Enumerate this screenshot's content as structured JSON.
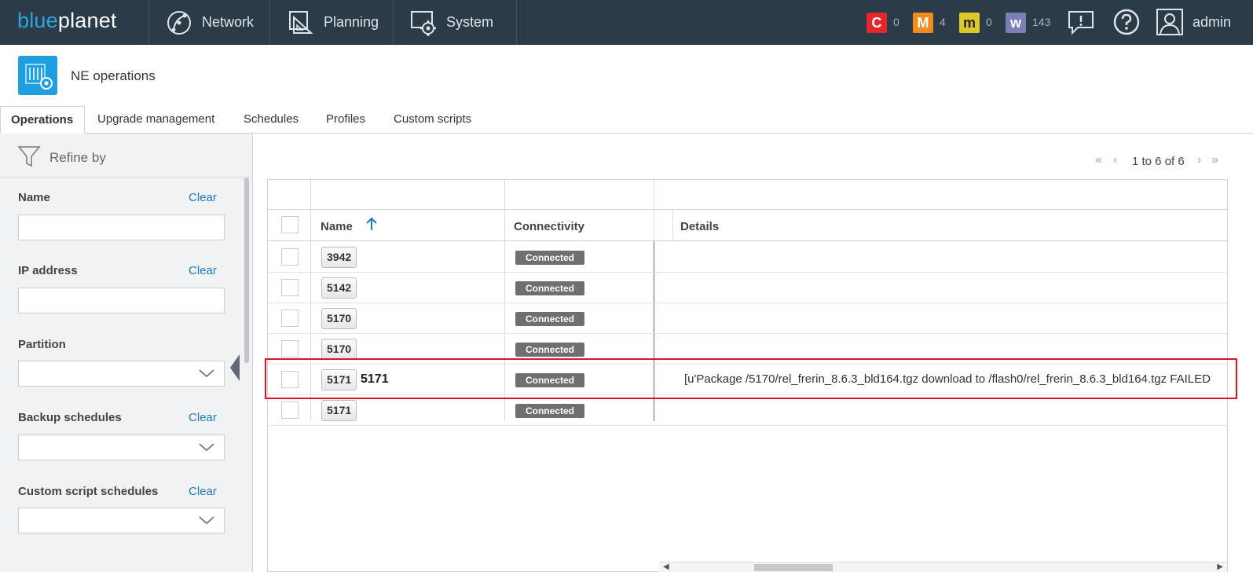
{
  "app": {
    "logo_blue": "blue",
    "logo_rest": "planet",
    "nav": [
      {
        "label": "Network",
        "icon": "network-icon"
      },
      {
        "label": "Planning",
        "icon": "planning-icon"
      },
      {
        "label": "System",
        "icon": "system-gear-icon"
      }
    ],
    "alarms": [
      {
        "letter": "C",
        "count": "0",
        "color": "#e3262b"
      },
      {
        "letter": "M",
        "count": "4",
        "color": "#f08c1e"
      },
      {
        "letter": "m",
        "count": "0",
        "color": "#d9c92a"
      },
      {
        "letter": "w",
        "count": "143",
        "color": "#7b7fb8"
      }
    ],
    "user": "admin"
  },
  "page": {
    "title": "NE operations",
    "tabs": [
      "Operations",
      "Upgrade management",
      "Schedules",
      "Profiles",
      "Custom scripts"
    ],
    "active_tab": "Operations"
  },
  "sidebar": {
    "refine_label": "Refine by",
    "clear_label": "Clear",
    "filters": [
      {
        "label": "Name",
        "type": "input",
        "value": ""
      },
      {
        "label": "IP address",
        "type": "input",
        "value": ""
      },
      {
        "label": "Partition",
        "type": "select",
        "value": ""
      },
      {
        "label": "Backup schedules",
        "type": "select",
        "value": ""
      },
      {
        "label": "Custom script schedules",
        "type": "select",
        "value": ""
      }
    ]
  },
  "pagination": {
    "text": "1 to 6 of 6"
  },
  "grid": {
    "columns": [
      "Name",
      "Connectivity",
      "Details"
    ],
    "sort_column": "Name",
    "rows": [
      {
        "type": "3942",
        "name": "",
        "connectivity": "Connected",
        "details": ""
      },
      {
        "type": "5142",
        "name": "",
        "connectivity": "Connected",
        "details": ""
      },
      {
        "type": "5170",
        "name": "",
        "connectivity": "Connected",
        "details": ""
      },
      {
        "type": "5170",
        "name": "",
        "connectivity": "Connected",
        "details": ""
      },
      {
        "type": "5171",
        "name": "5171",
        "connectivity": "Connected",
        "details": "[u'Package /5170/rel_frerin_8.6.3_bld164.tgz download to /flash0/rel_frerin_8.6.3_bld164.tgz FAILED"
      },
      {
        "type": "5171",
        "name": "",
        "connectivity": "Connected",
        "details": ""
      }
    ]
  }
}
